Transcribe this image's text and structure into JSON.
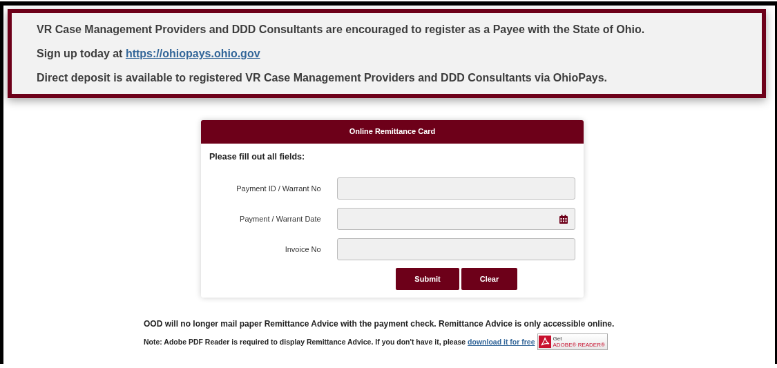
{
  "banner": {
    "lines": [
      {
        "kind": "text",
        "text": "VR Case Management Providers and DDD Consultants are encouraged to register as a Payee with the State of Ohio."
      },
      {
        "kind": "link",
        "text": "Sign up today at ",
        "link": "https://ohiopays.ohio.gov"
      },
      {
        "kind": "text",
        "text": "Direct deposit is available to registered VR Case Management Providers and DDD Consultants via OhioPays."
      }
    ]
  },
  "card": {
    "title": "Online Remittance Card",
    "instruction": "Please fill out all fields:",
    "fields": [
      {
        "label": "Payment ID / Warrant No",
        "kind": "text"
      },
      {
        "label": "Payment / Warrant Date",
        "kind": "date"
      },
      {
        "label": "Invoice No",
        "kind": "text"
      }
    ],
    "buttons": [
      "Submit",
      "Clear"
    ]
  },
  "notice": "OOD will no longer mail paper Remittance Advice with the payment check. Remittance Advice is only accessible online.",
  "note": {
    "text": "Note: Adobe PDF Reader is required to display Remittance Advice. If you don't have it, please ",
    "link": "download it for free",
    "badge": {
      "top": "Get",
      "bottom": "ADOBE® READER®"
    }
  }
}
